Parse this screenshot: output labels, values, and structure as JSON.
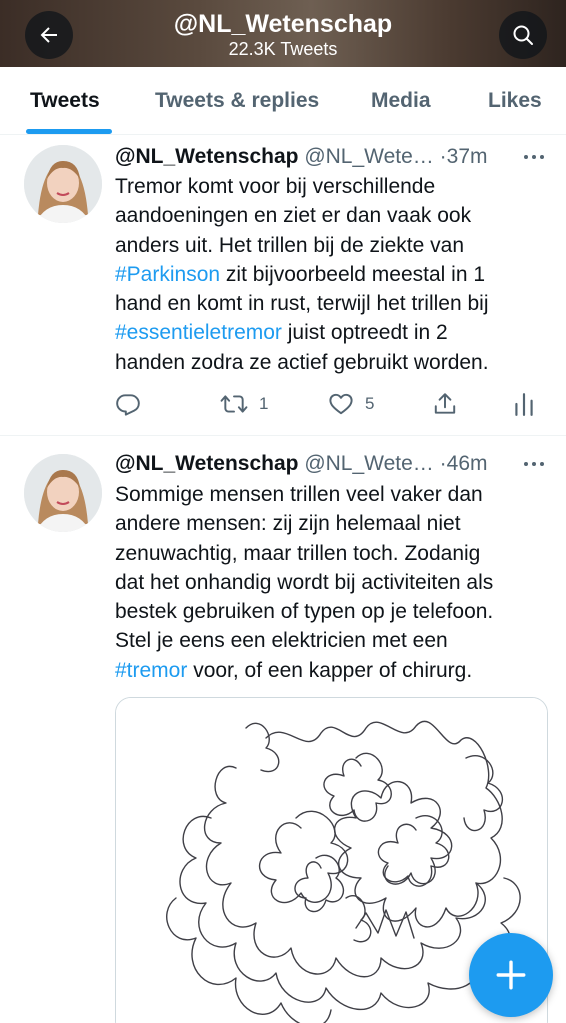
{
  "header": {
    "title": "@NL_Wetenschap",
    "subtitle": "22.3K Tweets",
    "back_icon": "arrow-left-icon",
    "search_icon": "search-icon",
    "bg_color": "#4a3b31"
  },
  "tabs": [
    {
      "label": "Tweets",
      "active": true
    },
    {
      "label": "Tweets & replies",
      "active": false
    },
    {
      "label": "Media",
      "active": false
    },
    {
      "label": "Likes",
      "active": false
    }
  ],
  "tweets": [
    {
      "name": "@NL_Wetenschap",
      "handle": "@NL_Wete…",
      "time": "·37m",
      "lines": [
        [
          {
            "t": "Tremor komt voor bij verschillende"
          }
        ],
        [
          {
            "t": "aandoeningen en ziet er dan vaak ook"
          }
        ],
        [
          {
            "t": "anders uit. Het trillen bij de ziekte van"
          }
        ],
        [
          {
            "t": "#Parkinson",
            "tag": true
          },
          {
            "t": " zit bijvoorbeeld meestal in 1"
          }
        ],
        [
          {
            "t": "hand en komt in rust, terwijl het trillen bij"
          }
        ],
        [
          {
            "t": "#essentieletremor",
            "tag": true
          },
          {
            "t": " juist optreedt in 2"
          }
        ],
        [
          {
            "t": "handen zodra ze actief gebruikt worden."
          }
        ]
      ],
      "replies": "",
      "retweets": "1",
      "likes": "5"
    },
    {
      "name": "@NL_Wetenschap",
      "handle": "@NL_Wete…",
      "time": "·46m",
      "lines": [
        [
          {
            "t": "Sommige mensen trillen veel vaker dan"
          }
        ],
        [
          {
            "t": "andere mensen: zij zijn helemaal niet"
          }
        ],
        [
          {
            "t": "zenuwachtig, maar trillen toch. Zodanig"
          }
        ],
        [
          {
            "t": "dat het onhandig wordt bij activiteiten als"
          }
        ],
        [
          {
            "t": "bestek gebruiken of typen op je telefoon."
          }
        ],
        [
          {
            "t": "Stel je eens een elektricien met een"
          }
        ],
        [
          {
            "t": "#tremor",
            "tag": true
          },
          {
            "t": " voor, of een kapper of chirurg."
          }
        ]
      ]
    }
  ],
  "icons": {
    "reply": "reply-icon",
    "retweet": "retweet-icon",
    "like": "heart-icon",
    "share": "share-icon",
    "analytics": "analytics-icon",
    "more": "more-dots-icon",
    "compose": "plus-icon"
  },
  "colors": {
    "accent": "#1d9bf0",
    "text": "#0f1419",
    "muted": "#536471"
  }
}
